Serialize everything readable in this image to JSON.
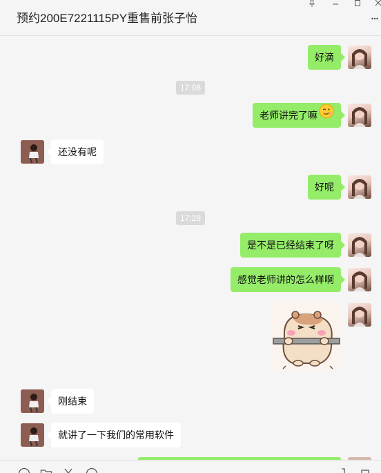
{
  "window": {
    "title": "预约200E7221115PY重售前张子怡"
  },
  "messages": [
    {
      "kind": "me",
      "text": "好滴"
    },
    {
      "kind": "time",
      "text": "17:06"
    },
    {
      "kind": "me",
      "text": "老师讲完了嘛",
      "emoji": "smiley-emoji"
    },
    {
      "kind": "them",
      "text": "还没有呢"
    },
    {
      "kind": "me",
      "text": "好呢"
    },
    {
      "kind": "time",
      "text": "17:28"
    },
    {
      "kind": "me",
      "text": "是不是已经结束了呀"
    },
    {
      "kind": "me",
      "text": "感觉老师讲的怎么样啊"
    },
    {
      "kind": "me-sticker",
      "sticker": "hamster-sticker"
    },
    {
      "kind": "them",
      "text": "刚结束"
    },
    {
      "kind": "them",
      "text": "就讲了一下我们的常用软件"
    }
  ],
  "colors": {
    "my_bubble": "#95ec69",
    "their_bubble": "#ffffff",
    "background": "#f5f5f5",
    "timestamp_bg": "#dadada"
  },
  "icons": {
    "pin": "pin-icon",
    "minimize": "minimize-icon",
    "maximize": "maximize-icon",
    "more": "more-options-icon",
    "toolbar": [
      "emoji-icon",
      "folder-icon",
      "scissors-icon",
      "chat-history-icon",
      "voice-call-icon",
      "video-call-icon"
    ]
  }
}
